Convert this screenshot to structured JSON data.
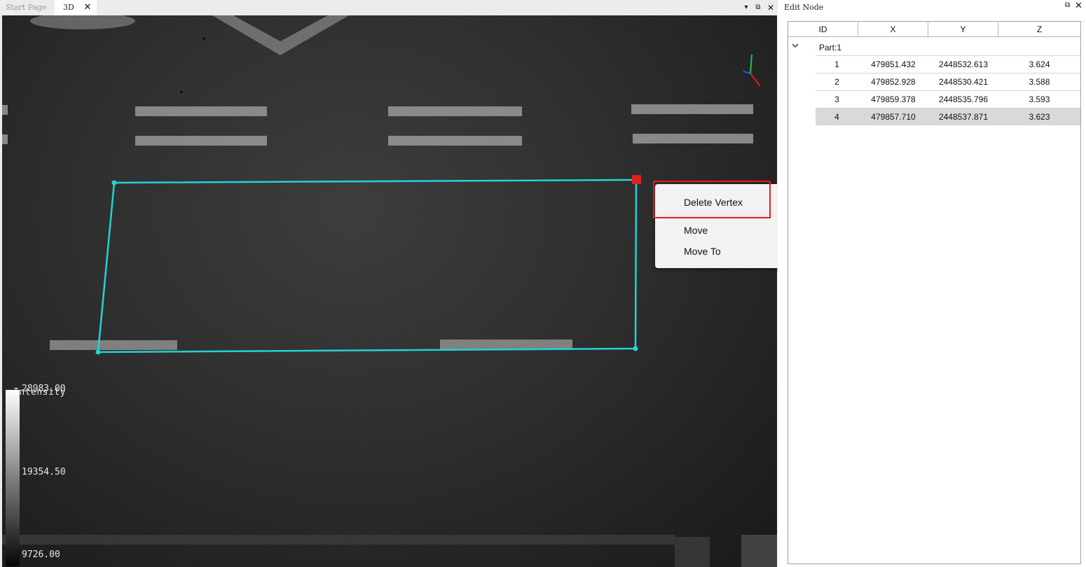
{
  "tabs": [
    {
      "label": "Start Page",
      "active": false
    },
    {
      "label": "3D",
      "active": true,
      "close": "✕"
    }
  ],
  "window_controls": {
    "dropdown": "▾",
    "float": "⧉",
    "close": "✕"
  },
  "viewport": {
    "legend": {
      "title": "Intensity",
      "max": "28983.00",
      "mid": "19354.50",
      "min": "9726.00"
    },
    "polygon_color": "#22d3d6",
    "selected_vertex_color": "#e0201b",
    "axes_icon": "xyz-axes-icon"
  },
  "context_menu": {
    "items": [
      "Delete Vertex",
      "Move",
      "Move To"
    ],
    "highlight_color": "#e0201b"
  },
  "panel": {
    "title": "Edit Node",
    "float_icon": "⧉",
    "close_icon": "✕",
    "columns": [
      "ID",
      "X",
      "Y",
      "Z"
    ],
    "part_label": "Part:1",
    "rows": [
      {
        "id": "1",
        "x": "479851.432",
        "y": "2448532.613",
        "z": "3.624"
      },
      {
        "id": "2",
        "x": "479852.928",
        "y": "2448530.421",
        "z": "3.588"
      },
      {
        "id": "3",
        "x": "479859.378",
        "y": "2448535.796",
        "z": "3.593"
      },
      {
        "id": "4",
        "x": "479857.710",
        "y": "2448537.871",
        "z": "3.623",
        "selected": true
      }
    ]
  }
}
